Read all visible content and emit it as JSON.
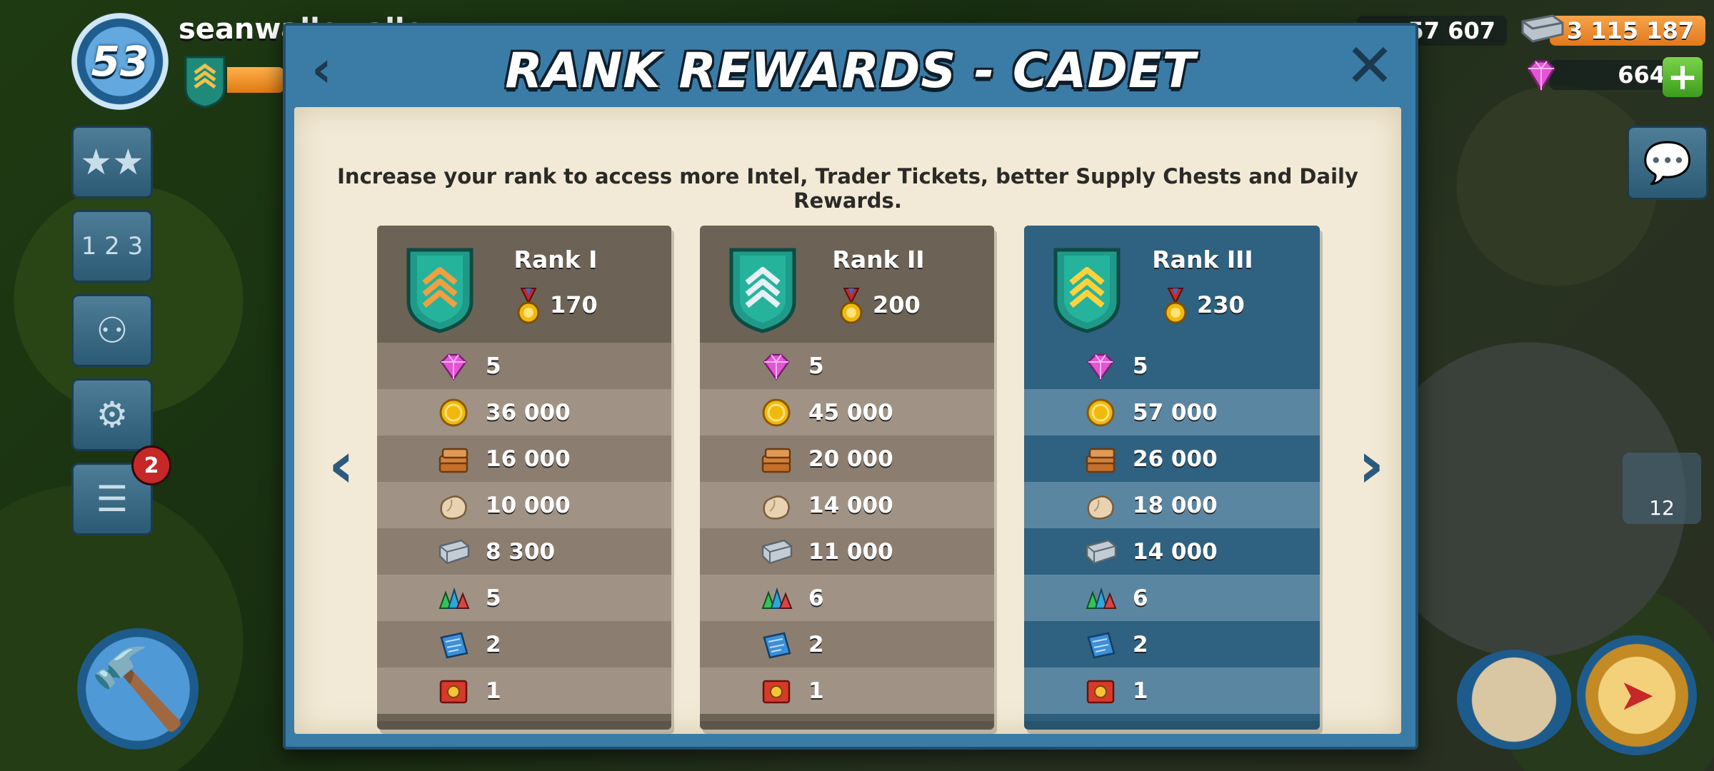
{
  "hud": {
    "level": "53",
    "player_name": "seanwallowalle",
    "notifications_count": "2",
    "resources": {
      "prev_resource_value": "57 607",
      "iron_value": "3 115 187",
      "gems_value": "664",
      "plus_label": "+"
    },
    "troops_count": "12"
  },
  "modal": {
    "title": "RANK REWARDS - CADET",
    "description": "Increase your rank to access more Intel, Trader Tickets, better Supply Chests and Daily Rewards.",
    "back_label": "‹",
    "close_label": "✕",
    "prev_label": "‹",
    "next_label": "›"
  },
  "ranks": [
    {
      "name": "Rank I",
      "medals": "170",
      "shield_color": "#f0a040",
      "rewards": [
        "5",
        "36 000",
        "16 000",
        "10 000",
        "8 300",
        "5",
        "2",
        "1"
      ]
    },
    {
      "name": "Rank II",
      "medals": "200",
      "shield_color": "#e6f0f5",
      "rewards": [
        "5",
        "45 000",
        "20 000",
        "14 000",
        "11 000",
        "6",
        "2",
        "1"
      ]
    },
    {
      "name": "Rank III",
      "medals": "230",
      "shield_color": "#ffd23a",
      "rewards": [
        "5",
        "57 000",
        "26 000",
        "18 000",
        "14 000",
        "6",
        "2",
        "1"
      ]
    }
  ],
  "reward_icons": [
    "diamond-icon",
    "gold-coin-icon",
    "wood-icon",
    "stone-icon",
    "iron-icon",
    "power-stones-icon",
    "intel-icon",
    "trader-ticket-icon"
  ],
  "colors": {
    "modal_blue": "#3b7ca6",
    "parchment": "#f2ead6",
    "card_brown": "#6d6256",
    "card_active": "#2d5f7d"
  }
}
